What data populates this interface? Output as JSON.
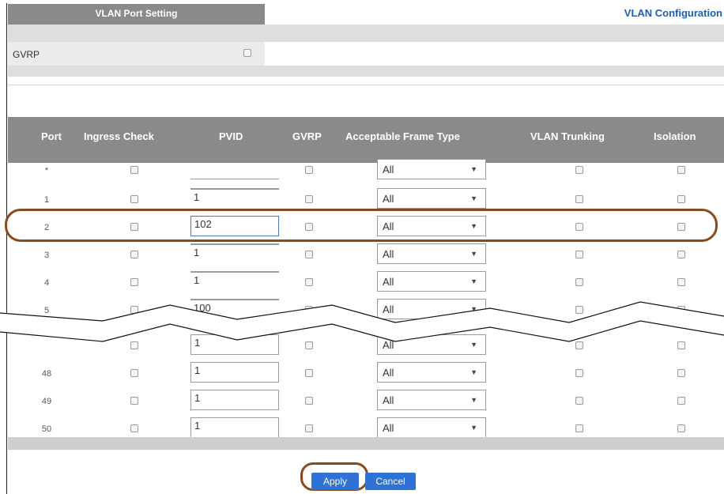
{
  "header": {
    "tab_title": "VLAN Port Setting",
    "config_link": "VLAN Configuration"
  },
  "gvrp": {
    "label": "GVRP",
    "checked": false
  },
  "table": {
    "columns": [
      "Port",
      "Ingress Check",
      "PVID",
      "GVRP",
      "Acceptable Frame Type",
      "VLAN Trunking",
      "Isolation"
    ],
    "rows": [
      {
        "port": "*",
        "pvid": "",
        "frame_type": "All"
      },
      {
        "port": "1",
        "pvid": "1",
        "frame_type": "All"
      },
      {
        "port": "2",
        "pvid": "102",
        "frame_type": "All"
      },
      {
        "port": "3",
        "pvid": "1",
        "frame_type": "All"
      },
      {
        "port": "4",
        "pvid": "1",
        "frame_type": "All"
      },
      {
        "port": "5",
        "pvid": "100",
        "frame_type": "All"
      },
      {
        "port": "",
        "pvid": "1",
        "frame_type": "All"
      },
      {
        "port": "48",
        "pvid": "1",
        "frame_type": "All"
      },
      {
        "port": "49",
        "pvid": "1",
        "frame_type": "All"
      },
      {
        "port": "50",
        "pvid": "1",
        "frame_type": "All"
      }
    ]
  },
  "buttons": {
    "apply": "Apply",
    "cancel": "Cancel"
  },
  "colors": {
    "accent": "#2f72d6",
    "highlight": "#8a4a1e",
    "header": "#8a8a8a"
  },
  "icons": {
    "dropdown": "chevron-down-icon"
  }
}
